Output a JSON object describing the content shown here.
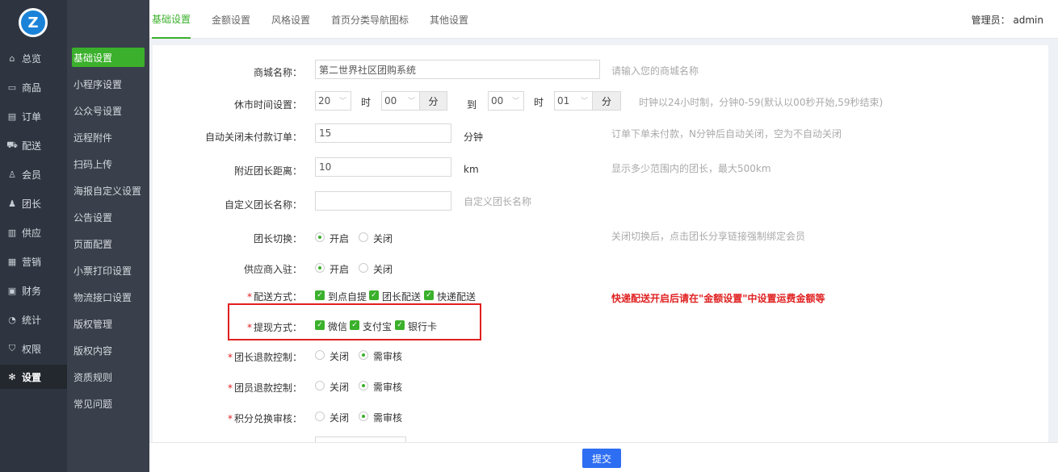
{
  "logo": {
    "letter": "Z"
  },
  "nav1": [
    {
      "label": "总览",
      "icon": "⌂"
    },
    {
      "label": "商品",
      "icon": "▭"
    },
    {
      "label": "订单",
      "icon": "▤"
    },
    {
      "label": "配送",
      "icon": "⛟"
    },
    {
      "label": "会员",
      "icon": "♙"
    },
    {
      "label": "团长",
      "icon": "♟"
    },
    {
      "label": "供应",
      "icon": "▥"
    },
    {
      "label": "营销",
      "icon": "▦"
    },
    {
      "label": "财务",
      "icon": "▣"
    },
    {
      "label": "统计",
      "icon": "◔"
    },
    {
      "label": "权限",
      "icon": "⛉"
    },
    {
      "label": "设置",
      "icon": "✻"
    }
  ],
  "nav2": [
    "基础设置",
    "小程序设置",
    "公众号设置",
    "远程附件",
    "扫码上传",
    "海报自定义设置",
    "公告设置",
    "页面配置",
    "小票打印设置",
    "物流接口设置",
    "版权管理",
    "版权内容",
    "资质规则",
    "常见问题"
  ],
  "tabs": [
    "基础设置",
    "金额设置",
    "风格设置",
    "首页分类导航图标",
    "其他设置"
  ],
  "admin": "管理员： admin",
  "form": {
    "shop_name": {
      "label": "商城名称：",
      "value": "第二世界社区团购系统",
      "hint": "请输入您的商城名称"
    },
    "close_time": {
      "label": "休市时间设置：",
      "start_hour": "20",
      "hour_unit": "时",
      "start_min": "00",
      "min_unit": "分",
      "to": "到",
      "end_hour": "00",
      "end_min": "01",
      "hint": "时钟以24小时制，分钟0-59(默认以00秒开始,59秒结束)"
    },
    "auto_close": {
      "label": "自动关闭未付款订单：",
      "value": "15",
      "unit": "分钟",
      "hint": "订单下单未付款，N分钟后自动关闭，空为不自动关闭"
    },
    "distance": {
      "label": "附近团长距离：",
      "value": "10",
      "unit": "km",
      "hint": "显示多少范围内的团长，最大500km"
    },
    "leader_name": {
      "label": "自定义团长名称：",
      "value": "",
      "hint": "自定义团长名称"
    },
    "leader_switch": {
      "label": "团长切换：",
      "opt1": "开启",
      "opt2": "关闭",
      "hint": "关闭切换后，点击团长分享链接强制绑定会员"
    },
    "supplier": {
      "label": "供应商入驻：",
      "opt1": "开启",
      "opt2": "关闭"
    },
    "delivery": {
      "label": "配送方式：",
      "req": "*",
      "opt1": "到点自提",
      "opt2": "团长配送",
      "opt3": "快递配送",
      "warn": "快递配送开启后请在\"金额设置\"中设置运费金额等"
    },
    "withdraw": {
      "label": "提现方式：",
      "req": "*",
      "opt1": "微信",
      "opt2": "支付宝",
      "opt3": "银行卡"
    },
    "leader_refund": {
      "label": "团长退款控制：",
      "req": "*",
      "opt1": "关闭",
      "opt2": "需审核"
    },
    "member_refund": {
      "label": "团员退款控制：",
      "req": "*",
      "opt1": "关闭",
      "opt2": "需审核"
    },
    "points_exchange": {
      "label": "积分兑换审核：",
      "req": "*",
      "opt1": "关闭",
      "opt2": "需审核"
    }
  },
  "submit": "提交",
  "colors": {
    "accent": "#3bb02c",
    "primary": "#2e6ef2",
    "danger": "#e02020"
  }
}
